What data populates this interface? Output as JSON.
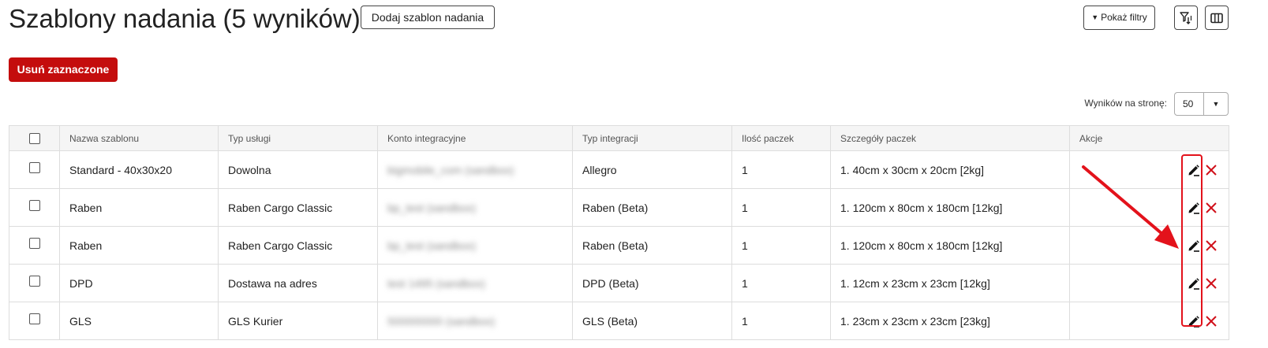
{
  "header": {
    "title": "Szablony nadania (5 wyników)",
    "add_button": "Dodaj szablon nadania",
    "filters_button": "Pokaż filtry",
    "sort_icon": "filter-sort-icon",
    "columns_icon": "columns-icon"
  },
  "toolbar": {
    "delete_selected": "Usuń zaznaczone",
    "per_page_label": "Wyników na stronę:",
    "per_page_value": "50"
  },
  "table": {
    "columns": [
      "Nazwa szablonu",
      "Typ usługi",
      "Konto integracyjne",
      "Typ integracji",
      "Ilość paczek",
      "Szczegóły paczek",
      "Akcje"
    ],
    "rows": [
      {
        "name": "Standard - 40x30x20",
        "service": "Dowolna",
        "account": "bigmobile_com (sandbox)",
        "integration": "Allegro",
        "count": "1",
        "details": "1. 40cm x 30cm x 20cm [2kg]"
      },
      {
        "name": "Raben",
        "service": "Raben Cargo Classic",
        "account": "bp_test (sandbox)",
        "integration": "Raben (Beta)",
        "count": "1",
        "details": "1. 120cm x 80cm x 180cm [12kg]"
      },
      {
        "name": "Raben",
        "service": "Raben Cargo Classic",
        "account": "bp_test (sandbox)",
        "integration": "Raben (Beta)",
        "count": "1",
        "details": "1. 120cm x 80cm x 180cm [12kg]"
      },
      {
        "name": "DPD",
        "service": "Dostawa na adres",
        "account": "test 1495 (sandbox)",
        "integration": "DPD (Beta)",
        "count": "1",
        "details": "1. 12cm x 23cm x 23cm [12kg]"
      },
      {
        "name": "GLS",
        "service": "GLS Kurier",
        "account": "500000000 (sandbox)",
        "integration": "GLS (Beta)",
        "count": "1",
        "details": "1. 23cm x 23cm x 23cm [23kg]"
      }
    ]
  },
  "icons": {
    "edit": "pencil-icon",
    "delete": "close-icon"
  },
  "colors": {
    "danger": "#c40d0d",
    "annotation": "#e3121b",
    "delete_icon": "#d0101a"
  }
}
